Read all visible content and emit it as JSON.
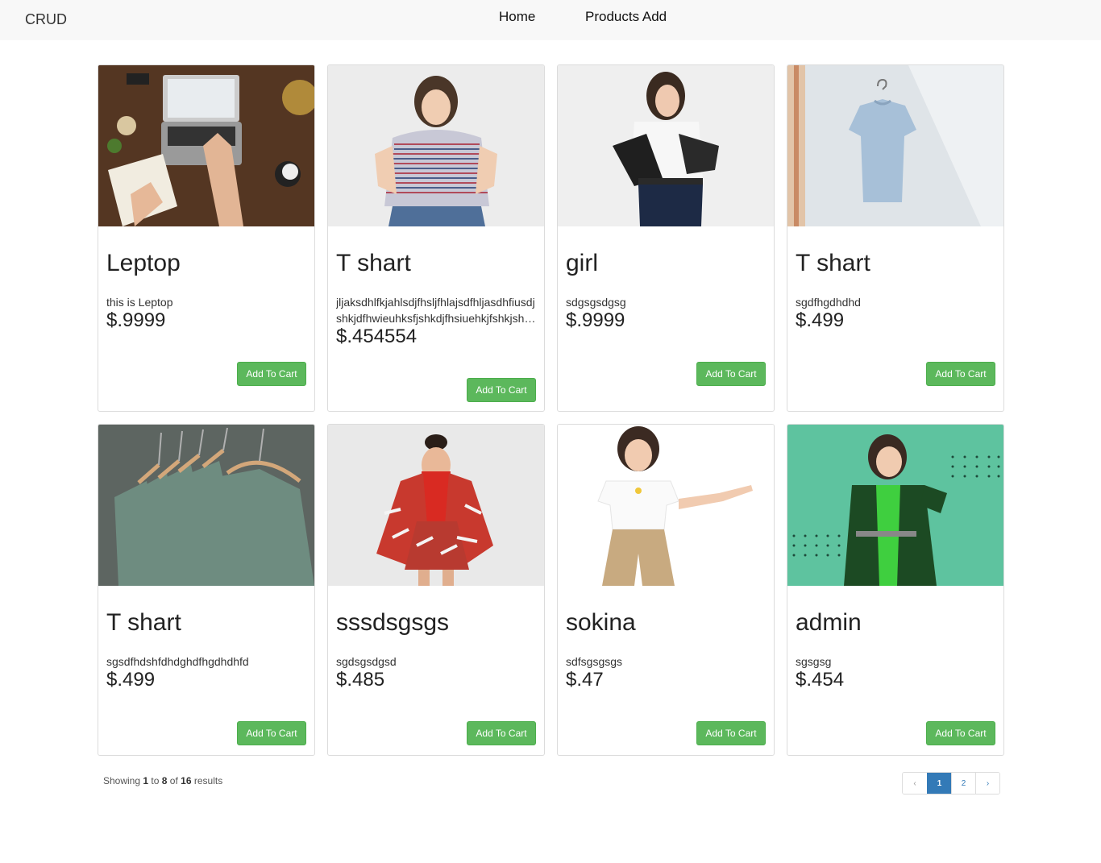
{
  "nav": {
    "brand": "CRUD",
    "links": [
      "Home",
      "Products Add"
    ]
  },
  "products": [
    {
      "title": "Leptop",
      "description": "this is Leptop",
      "price": "$.9999",
      "button": "Add To Cart",
      "image": "laptop-desk-photo"
    },
    {
      "title": "T shart",
      "description": "jljaksdhlfkjahlsdjfhsljfhlajsdfhljasdhfiusdjshkjdfhwieuhksfjshkdjfhsiuehkjfshkjshdfkjshd",
      "price": "$.454554",
      "button": "Add To Cart",
      "image": "woman-striped-tshirt-photo"
    },
    {
      "title": "girl",
      "description": "sdgsgsdgsg",
      "price": "$.9999",
      "button": "Add To Cart",
      "image": "woman-leather-jacket-photo"
    },
    {
      "title": "T shart",
      "description": "sgdfhgdhdhd",
      "price": "$.499",
      "button": "Add To Cart",
      "image": "tshirt-on-hanger-photo"
    },
    {
      "title": "T shart",
      "description": "sgsdfhdshfdhdghdfhgdhdhfd",
      "price": "$.499",
      "button": "Add To Cart",
      "image": "green-shirts-rack-photo"
    },
    {
      "title": "sssdsgsgs",
      "description": "sgdsgsdgsd",
      "price": "$.485",
      "button": "Add To Cart",
      "image": "woman-red-print-suit-photo"
    },
    {
      "title": "sokina",
      "description": "sdfsgsgsgs",
      "price": "$.47",
      "button": "Add To Cart",
      "image": "woman-white-tee-photo"
    },
    {
      "title": "admin",
      "description": "sgsgsg",
      "price": "$.454",
      "button": "Add To Cart",
      "image": "woman-green-blazer-photo"
    }
  ],
  "footer": {
    "showing_prefix": "Showing",
    "from": "1",
    "to_word": "to",
    "to": "8",
    "of_word": "of",
    "total": "16",
    "results_word": "results"
  },
  "pagination": {
    "prev": "‹",
    "pages": [
      "1",
      "2"
    ],
    "next": "›",
    "current": "1"
  },
  "colors": {
    "button_green": "#5cb85c",
    "page_active": "#337ab7",
    "navbar_bg": "#f8f8f8"
  }
}
